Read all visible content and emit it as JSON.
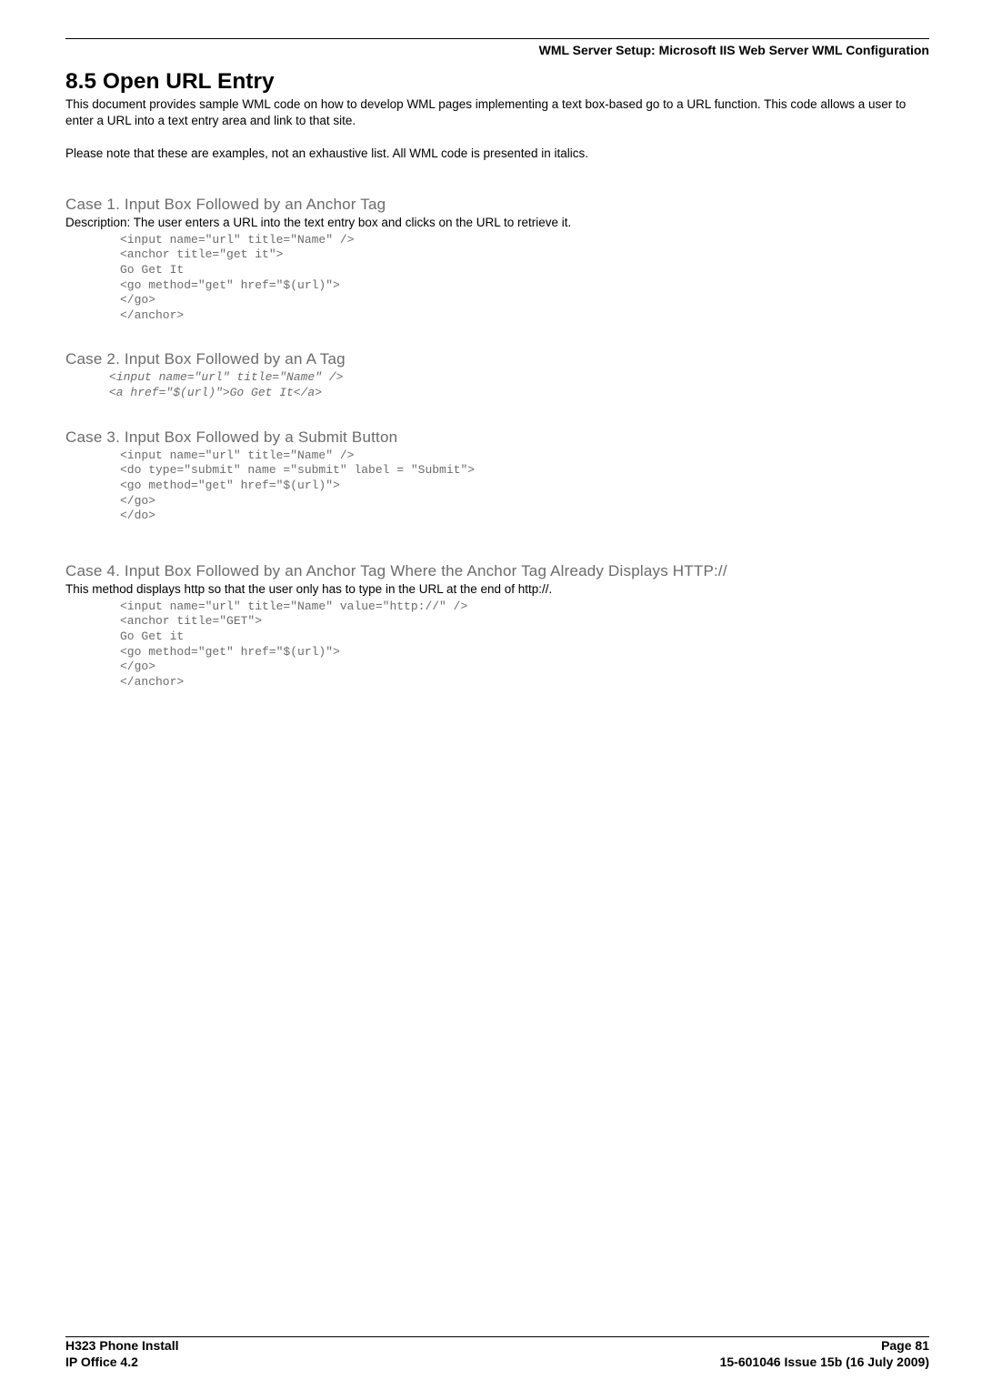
{
  "header": {
    "right": "WML Server Setup: Microsoft IIS Web Server WML Configuration"
  },
  "section": {
    "title": "8.5 Open URL Entry",
    "intro1": "This document provides sample WML code on how to develop WML pages implementing a text box-based go to a URL function. This code allows a user to enter a URL into a text entry area and link to that site.",
    "intro2": "Please note that these are examples, not an exhaustive list. All WML code is presented in italics."
  },
  "case1": {
    "heading": "Case 1. Input Box Followed by an Anchor Tag",
    "desc": "Description: The user enters a URL into the text entry box and clicks on the URL to retrieve it.",
    "code": "<input name=\"url\" title=\"Name\" />\n<anchor title=\"get it\">\nGo Get It\n<go method=\"get\" href=\"$(url)\">\n</go>\n</anchor>"
  },
  "case2": {
    "heading": "Case 2. Input Box Followed by an A Tag",
    "code": "<input name=\"url\" title=\"Name\" />\n<a href=\"$(url)\">Go Get It</a>"
  },
  "case3": {
    "heading": "Case 3. Input Box Followed by a Submit Button",
    "code": "<input name=\"url\" title=\"Name\" />\n<do type=\"submit\" name =\"submit\" label = \"Submit\">\n<go method=\"get\" href=\"$(url)\">\n</go>\n</do>"
  },
  "case4": {
    "heading": "Case 4. Input Box Followed by an Anchor Tag Where the Anchor Tag Already Displays HTTP://",
    "desc": "This method displays http so that the user only has to type in the URL at the end of http://.",
    "code": "<input name=\"url\" title=\"Name\" value=\"http://\" />\n<anchor title=\"GET\">\nGo Get it\n<go method=\"get\" href=\"$(url)\">\n</go>\n</anchor>"
  },
  "footer": {
    "left1": "H323 Phone Install",
    "left2": "IP Office 4.2",
    "right1": "Page 81",
    "right2": "15-601046 Issue 15b (16 July 2009)"
  }
}
